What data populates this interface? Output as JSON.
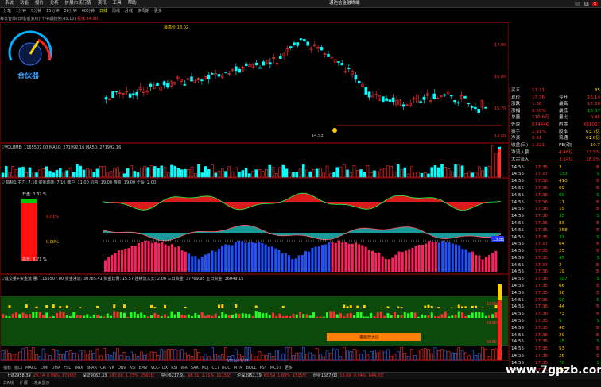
{
  "window": {
    "menus": [
      "系统",
      "功能",
      "报价",
      "分析",
      "扩展市场行情",
      "资讯",
      "工具",
      "帮助"
    ],
    "title": "通达信金融终端",
    "controls": [
      "_",
      "□",
      "×"
    ]
  },
  "periods": [
    "分笔",
    "1分钟",
    "5分钟",
    "15分钟",
    "30分钟",
    "60分钟",
    "日线",
    "周线",
    "月线",
    "多周期",
    "更多"
  ],
  "active_period": "日线",
  "info_line": {
    "left": "每日智策(日线/前复权) 个中期趋势(45,10)",
    "highlight": "看涨:14.90"
  },
  "gauge": {
    "label": "合伙器"
  },
  "kline": {
    "peak_note": "最高价:18.02",
    "low_note": "14.53",
    "price_labels": [
      "17.90",
      "16.80",
      "15.70",
      "14.60"
    ]
  },
  "volume_panel": {
    "header": "▽VOLUME: 1165507.00  MA50: 271992.16  MA50: 271992.16"
  },
  "fund_panel": {
    "header": "▽ 指标1  主力: 7.16  资金动能: 7.16  散户: 11.00  机构: 19.00  游资: 19.00  个股: 2.00",
    "up_ratio": "开盘: 0.87 %",
    "mid_ratio": "0.01%",
    "low_ratio": "0.00%",
    "down_ratio": "高低: 8.71 %",
    "badge": "13.85"
  },
  "lower_panel": {
    "header": "▽成交量+资金流  量: 1165507.00  资金净流: 30785.41  资金比例: 15.57  连续流入天: 2.00  三日资金: 37769.95  五日资金: 36049.15",
    "orange_label": "量能放大区",
    "date_label": "2019/07/23",
    "y_labels": [
      "15000",
      "10000",
      "5000"
    ]
  },
  "quote": {
    "rows": [
      {
        "k": "买五",
        "v": "17.31",
        "v2": "85"
      },
      {
        "k": "现价",
        "v": "17.36",
        "k2": "今开",
        "v3": "16.14"
      },
      {
        "k": "涨跌",
        "v": "1.36",
        "k2": "最高",
        "v3": "17.38"
      },
      {
        "k": "涨幅",
        "v": "8.50%",
        "k2": "最低",
        "v3": "16.07"
      },
      {
        "k": "总量",
        "v": "116.6万",
        "k2": "量比",
        "v3": "0.46"
      },
      {
        "k": "外盘",
        "v": "674446",
        "k2": "内盘",
        "v3": "491067"
      },
      {
        "k": "换手",
        "v": "1.91%",
        "k2": "股本",
        "v3": "63.7亿"
      },
      {
        "k": "净资",
        "v": "6.91",
        "k2": "流通",
        "v3": "61.0亿"
      },
      {
        "k": "收益(三)",
        "v": "1.221",
        "k2": "PE(动)",
        "v3": "10.7"
      }
    ],
    "flow": [
      {
        "k": "净流入额",
        "v": "4.46亿",
        "v2": "22.5%"
      },
      {
        "k": "大宗流入",
        "v": "3.54亿",
        "v2": "18.0%"
      }
    ],
    "ticks": [
      {
        "t": "14:55",
        "p": "17.35",
        "v": "3"
      },
      {
        "t": "14:55",
        "p": "17.37",
        "v": "133"
      },
      {
        "t": "14:55",
        "p": "17.36",
        "v": "410"
      },
      {
        "t": "14:55",
        "p": "17.36",
        "v": "69"
      },
      {
        "t": "14:55",
        "p": "17.36",
        "v": "69"
      },
      {
        "t": "14:55",
        "p": "17.36",
        "v": "11"
      },
      {
        "t": "14:55",
        "p": "17.36",
        "v": "15"
      },
      {
        "t": "14:55",
        "p": "17.36",
        "v": "35"
      },
      {
        "t": "14:55",
        "p": "17.36",
        "v": "83"
      },
      {
        "t": "14:55",
        "p": "17.35",
        "v": "258"
      },
      {
        "t": "14:55",
        "p": "17.35",
        "v": "31"
      },
      {
        "t": "14:55",
        "p": "17.37",
        "v": "64"
      },
      {
        "t": "14:55",
        "p": "17.35",
        "v": "25"
      },
      {
        "t": "14:55",
        "p": "17.35",
        "v": "45"
      },
      {
        "t": "14:55",
        "p": "17.37",
        "v": "2"
      },
      {
        "t": "14:55",
        "p": "17.36",
        "v": "19"
      },
      {
        "t": "14:55",
        "p": "17.36",
        "v": "107"
      },
      {
        "t": "14:55",
        "p": "17.35",
        "v": "66"
      },
      {
        "t": "14:55",
        "p": "17.35",
        "v": "38"
      },
      {
        "t": "14:55",
        "p": "17.36",
        "v": "50"
      },
      {
        "t": "14:55",
        "p": "17.36",
        "v": "44"
      },
      {
        "t": "14:55",
        "p": "17.36",
        "v": "73"
      },
      {
        "t": "14:55",
        "p": "17.35",
        "v": "9"
      },
      {
        "t": "14:55",
        "p": "17.35",
        "v": "40"
      },
      {
        "t": "14:55",
        "p": "17.36",
        "v": "29"
      },
      {
        "t": "14:55",
        "p": "17.35",
        "v": "15"
      },
      {
        "t": "14:55",
        "p": "17.35",
        "v": "53"
      },
      {
        "t": "14:55",
        "p": "17.36",
        "v": "26"
      },
      {
        "t": "14:55",
        "p": "17.35",
        "v": "70"
      },
      {
        "t": "14:55",
        "p": "17.35",
        "v": "49"
      },
      {
        "t": "14:55",
        "p": "17.35",
        "v": "100"
      },
      {
        "t": "14:56",
        "p": "17.35",
        "v": "1"
      },
      {
        "t": "15:00",
        "p": "17.36",
        "v": "1"
      }
    ]
  },
  "bottom_tabs": [
    "指标",
    "窗口",
    "MACD",
    "DMI",
    "DMA",
    "FSL",
    "TRIX",
    "BRAR",
    "CR",
    "VR",
    "OBV",
    "ASI",
    "EMV",
    "VOL-TDX",
    "RSI",
    "WR",
    "SAR",
    "KDJ",
    "CCI",
    "ROC",
    "MTM",
    "BOLL",
    "PSY",
    "MCST",
    "更多"
  ],
  "status": [
    "上证2958.39",
    "29.14",
    "0.99%",
    "1750亿",
    "深证9062.33",
    "167.00",
    "1.73%",
    "2565亿",
    "中小6217.91",
    "98.31",
    "1.11%",
    "1115亿",
    "沪深3952.39",
    "65.59",
    "1.69%",
    "1515亿",
    "创业1587.00",
    "15.69",
    "0.94%",
    "844.0亿"
  ],
  "footer": [
    "日K线",
    "扩展",
    "未来显示"
  ],
  "watermark": "www.7gpzb.com",
  "colors": {
    "up": "#ff3030",
    "down": "#00ffff",
    "bg": "#000000",
    "grid": "#5a0000"
  }
}
